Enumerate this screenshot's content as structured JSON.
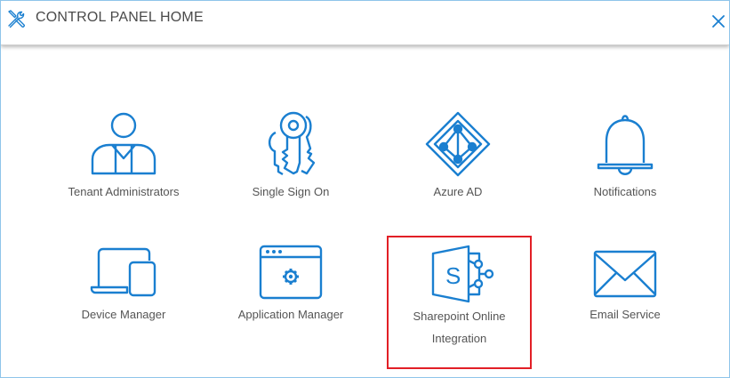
{
  "header": {
    "title": "CONTROL PANEL HOME",
    "tools_icon": "tools-icon",
    "close_icon": "close-icon"
  },
  "colors": {
    "accent": "#1a7fd0",
    "selection": "#e21f26",
    "label_text": "#555555"
  },
  "tiles": [
    {
      "label": "Tenant Administrators",
      "icon": "user-admin-icon"
    },
    {
      "label": "Single Sign On",
      "icon": "keys-icon"
    },
    {
      "label": "Azure AD",
      "icon": "azure-ad-icon"
    },
    {
      "label": "Notifications",
      "icon": "bell-icon"
    },
    {
      "label": "Device Manager",
      "icon": "devices-icon"
    },
    {
      "label": "Application Manager",
      "icon": "app-window-gear-icon"
    },
    {
      "label": "Sharepoint Online Integration",
      "label_line1": "Sharepoint Online",
      "label_line2": "Integration",
      "icon": "sharepoint-icon",
      "selected": true
    },
    {
      "label": "Email Service",
      "icon": "envelope-icon"
    }
  ]
}
